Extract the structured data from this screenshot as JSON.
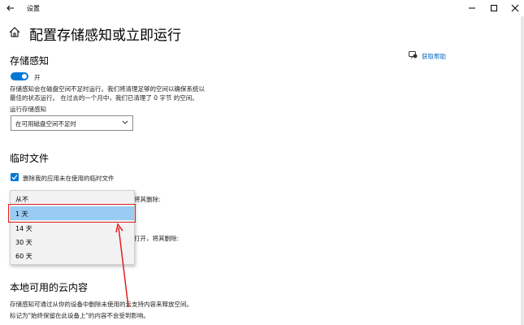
{
  "window": {
    "title": "设置",
    "back_icon": "back-arrow-icon",
    "controls": [
      "minimize-icon",
      "maximize-icon",
      "close-icon"
    ]
  },
  "page": {
    "title": "配置存储感知或立即运行",
    "home_icon": "home-icon"
  },
  "help": {
    "label": "获取帮助",
    "icon": "help-chat-icon"
  },
  "storage_sense": {
    "heading": "存储感知",
    "toggle_state": "开",
    "toggle_on": true,
    "desc_line1": "存储感知会在磁盘空间不足时运行。我们将清理足够的空间以确保系统以",
    "desc_line2": "最佳的状态运行。 在过去的一个月中，我们已清理了 0 字节 的空间。",
    "run_label": "运行存储感知",
    "run_value": "在可用磁盘空间不足时"
  },
  "temp_files": {
    "heading": "临时文件",
    "checkbox_label": "删除我的应用未在使用的临时文件",
    "checked": true,
    "partial_text_1": "将其删除:",
    "partial_text_2": "打开，将其删除:",
    "dropdown_options": [
      "从不",
      "1 天",
      "14 天",
      "30 天",
      "60 天"
    ],
    "selected_index": 1
  },
  "cloud": {
    "heading": "本地可用的云内容",
    "line1": "存储感知可通过从你的设备中删除未使用的云支持内容来释放空间。",
    "line2": "标记为\"始终保留在此设备上\"的内容不会受到影响。"
  },
  "annotation_color": "#e02020",
  "accent_color": "#0078d4"
}
